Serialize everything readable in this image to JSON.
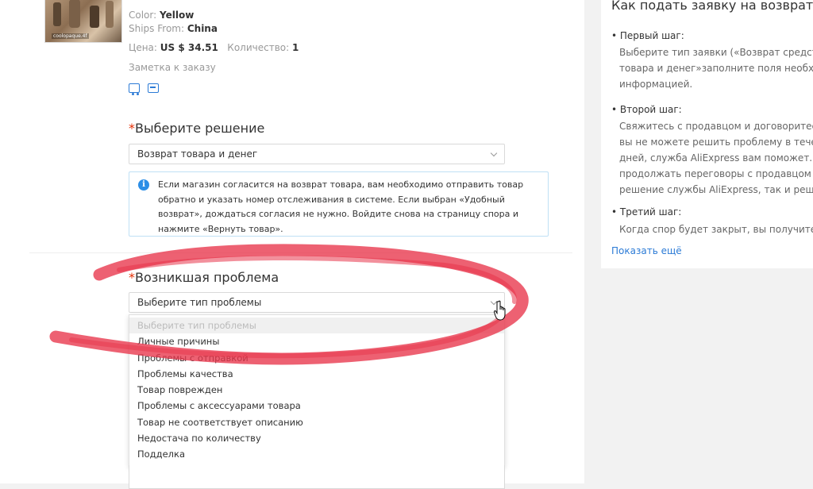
{
  "product": {
    "thumbnail_watermark": "coolopaque.4f",
    "color_label": "Color:",
    "color_value": "Yellow",
    "ships_from_label": "Ships From:",
    "ships_from_value": "China",
    "price_label": "Цена:",
    "price_value": "US $ 34.51",
    "quantity_label": "Количество:",
    "quantity_value": "1",
    "order_note": "Заметка к заказу"
  },
  "solution": {
    "label": "Выберите решение",
    "selected": "Возврат товара и денег",
    "info_lines": [
      "Если магазин согласится на возврат товара, вам необходимо отправить товар",
      "обратно и указать номер отслеживания в системе. Если выбран «Удобный",
      "возврат», дождаться согласия не нужно. Войдите снова на страницу спора и",
      "нажмите «Вернуть товар»."
    ]
  },
  "problem": {
    "label": "Возникшая проблема",
    "placeholder": "Выберите тип проблемы",
    "options": [
      "Выберите тип проблемы",
      "Личные причины",
      "Проблемы с отправкой",
      "Проблемы качества",
      "Товар поврежден",
      "Проблемы с аксессуарами товара",
      "Товар не соответствует описанию",
      "Недостача по количеству",
      "Подделка"
    ]
  },
  "guide": {
    "title": "Как подать заявку на возврат",
    "steps": [
      {
        "title": "• Первый шаг:",
        "lines": [
          "Выберите тип заявки («Возврат средств",
          "товара и денег»заполните поля необхо",
          "информацией."
        ]
      },
      {
        "title": "• Второй шаг:",
        "lines": [
          "Свяжитесь с продавцом и договоритесь",
          "вы не можете решить проблему в течен",
          "дней, служба AliExpress вам поможет. Пр",
          "продолжать переговоры с продавцом и",
          "решение службы AliExpress, так и решен"
        ]
      },
      {
        "title": "• Третий шаг:",
        "lines": [
          "Когда спор будет закрыт, вы получите в"
        ]
      }
    ],
    "show_more": "Показать ещё"
  },
  "colors": {
    "accent_blue": "#2c7bd6",
    "required_red": "#e62e04",
    "annotation_red": "#e8354a",
    "info_border": "#bfe0f5"
  }
}
